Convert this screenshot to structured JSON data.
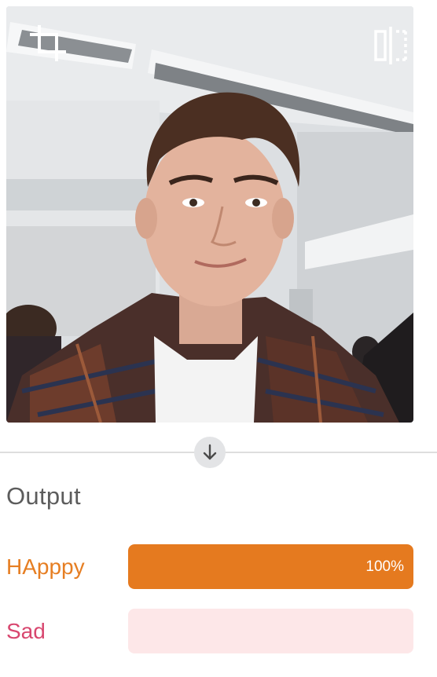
{
  "image": {
    "crop_icon": "crop-icon",
    "flip_icon": "flip-horizontal-icon"
  },
  "divider_icon": "arrow-down-icon",
  "output": {
    "heading": "Output",
    "predictions": [
      {
        "label": "HApppy",
        "value_text": "100%",
        "fraction": 1.0,
        "color": "#e57a1f"
      },
      {
        "label": "Sad",
        "value_text": "",
        "fraction": 0.0,
        "color": "#d8476f"
      }
    ]
  },
  "colors": {
    "happy_label": "#e67e22",
    "sad_label": "#d8476f",
    "track": "#fde7e8"
  }
}
